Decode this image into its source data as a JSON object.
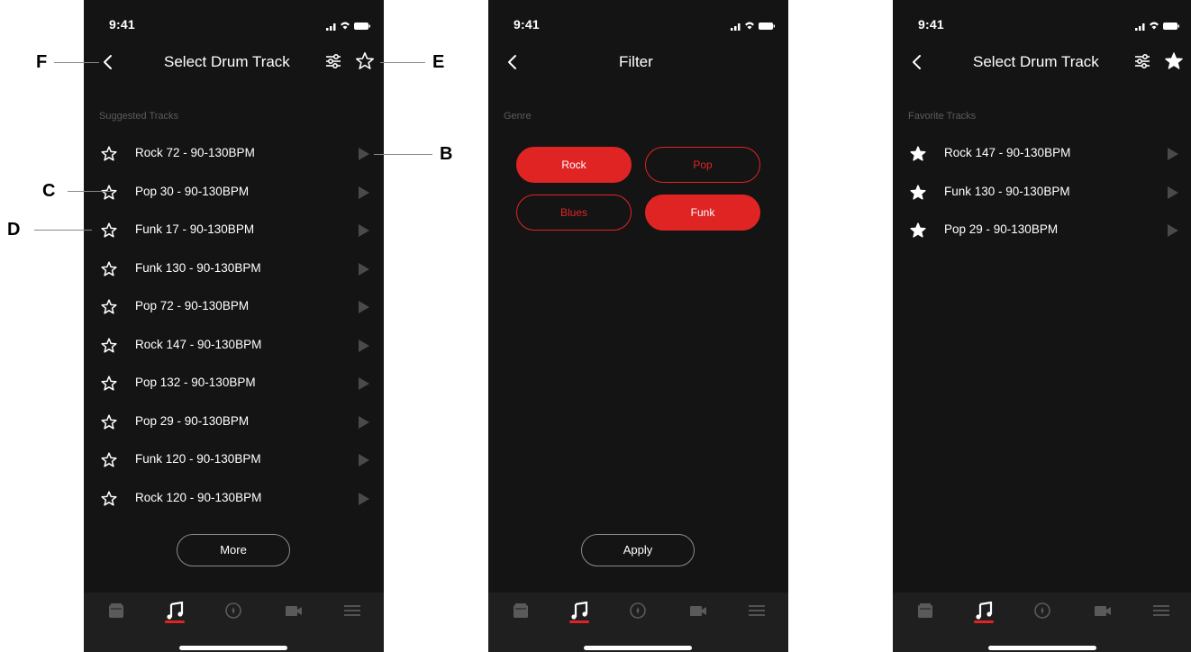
{
  "status": {
    "time": "9:41"
  },
  "screen1": {
    "title": "Select Drum Track",
    "section": "Suggested Tracks",
    "tracks": [
      "Rock 72 - 90-130BPM",
      "Pop 30 - 90-130BPM",
      "Funk 17 - 90-130BPM",
      "Funk 130 - 90-130BPM",
      "Pop 72 - 90-130BPM",
      "Rock 147 - 90-130BPM",
      "Pop 132 - 90-130BPM",
      "Pop 29 - 90-130BPM",
      "Funk 120 - 90-130BPM",
      "Rock 120 - 90-130BPM"
    ],
    "more_label": "More"
  },
  "screen2": {
    "title": "Filter",
    "section": "Genre",
    "genres": [
      {
        "label": "Rock",
        "selected": true
      },
      {
        "label": "Pop",
        "selected": false
      },
      {
        "label": "Blues",
        "selected": false
      },
      {
        "label": "Funk",
        "selected": true
      }
    ],
    "apply_label": "Apply"
  },
  "screen3": {
    "title": "Select Drum Track",
    "section": "Favorite Tracks",
    "tracks": [
      "Rock 147 - 90-130BPM",
      "Funk 130 - 90-130BPM",
      "Pop 29 - 90-130BPM"
    ]
  },
  "tabs": [
    "amp-icon",
    "music-note-icon",
    "compass-icon",
    "video-camera-icon",
    "menu-icon"
  ],
  "active_tab": "music-note-icon",
  "callouts": {
    "b": "B",
    "c": "C",
    "d": "D",
    "e": "E",
    "f": "F"
  },
  "colors": {
    "accent": "#e02424",
    "background": "#141414",
    "tabbar": "#1f1f1f",
    "muted": "#5c5c5c"
  }
}
